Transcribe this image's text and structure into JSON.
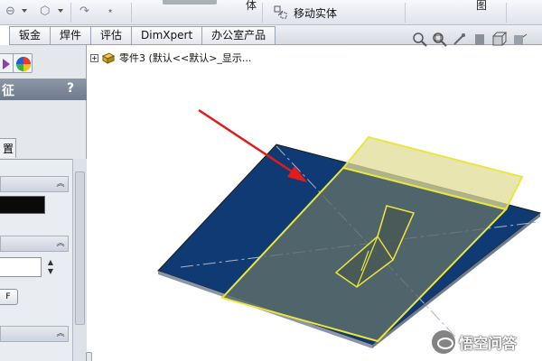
{
  "toolbar": {
    "partial_text_left": "体",
    "move_label": "移动实体",
    "partial_text_right": "图"
  },
  "tabs": [
    "钣金",
    "焊件",
    "评估",
    "DimXpert",
    "办公室产品"
  ],
  "property_manager": {
    "title": "征",
    "help": "?",
    "sub_tab": "置",
    "f_button": "F"
  },
  "feature_tree": {
    "expand": "+",
    "label": "零件3 (默认<<默认>_显示..."
  },
  "watermark": {
    "text": "悟空问答"
  },
  "colors": {
    "plane_fill": "#0f3a74",
    "highlight": "#e9e640",
    "arrow": "#e01c1c",
    "panel_title": "#7a8496"
  }
}
